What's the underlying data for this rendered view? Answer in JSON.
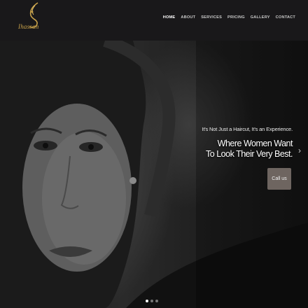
{
  "brand": {
    "name": "Ihassan",
    "accent_color": "#c9a24a"
  },
  "nav": {
    "items": [
      {
        "label": "HOME",
        "active": true
      },
      {
        "label": "ABOUT"
      },
      {
        "label": "SERVICES"
      },
      {
        "label": "PRICING"
      },
      {
        "label": "GALLERY"
      },
      {
        "label": "CONTACT"
      }
    ]
  },
  "hero": {
    "tagline": "It's Not Just a Haircut, It's an Experience.",
    "headline_line1": "Where Women Want",
    "headline_line2": "To Look Their Very Best.",
    "cta_label": "Call us",
    "cta_color": "#6e6560",
    "next_icon": "chevron-right-icon",
    "slide_count": 3,
    "active_slide": 1
  }
}
